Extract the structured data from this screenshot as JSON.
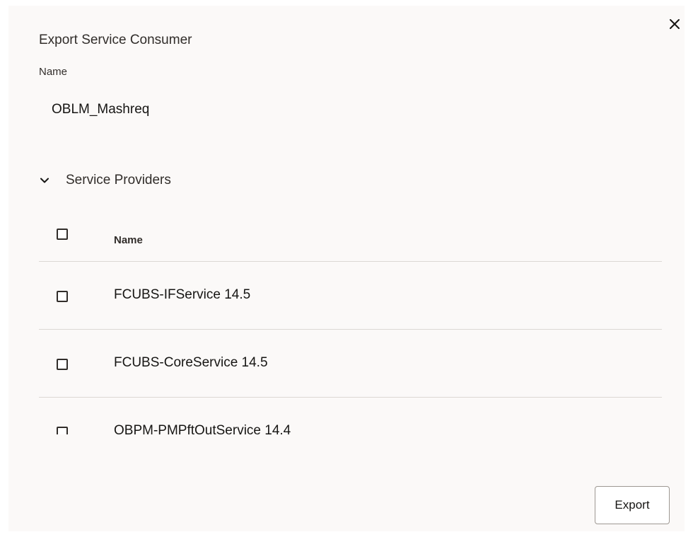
{
  "dialog": {
    "title": "Export Service Consumer",
    "close_icon": "close-icon"
  },
  "consumer": {
    "name_label": "Name",
    "name_value": "OBLM_Mashreq"
  },
  "service_providers": {
    "section_label": "Service Providers",
    "expanded": true,
    "toggle_icon": "chevron-down-icon",
    "column_header": "Name",
    "rows": [
      {
        "name": "FCUBS-IFService 14.5",
        "checked": false
      },
      {
        "name": "FCUBS-CoreService 14.5",
        "checked": false
      },
      {
        "name": "OBPM-PMPftOutService 14.4",
        "checked": false
      }
    ]
  },
  "footer": {
    "export_label": "Export"
  }
}
